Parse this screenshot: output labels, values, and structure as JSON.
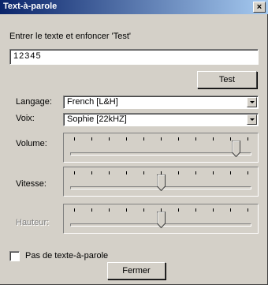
{
  "window": {
    "title": "Text-à-parole",
    "close_label": "×"
  },
  "instruction": "Entrer le texte et enfoncer 'Test'",
  "test_text": {
    "value": "12345"
  },
  "buttons": {
    "test": "Test",
    "close": "Fermer"
  },
  "language": {
    "label": "Langage:",
    "selected": "French [L&H]"
  },
  "voice": {
    "label": "Voix:",
    "selected": "Sophie [22kHZ]"
  },
  "sliders": [
    {
      "key": "volume",
      "label": "Volume:",
      "value": 0.93,
      "ticks": 11,
      "enabled": true
    },
    {
      "key": "vitesse",
      "label": "Vitesse:",
      "value": 0.5,
      "ticks": 11,
      "enabled": true
    },
    {
      "key": "hauteur",
      "label": "Hauteur:",
      "value": 0.5,
      "ticks": 11,
      "enabled": false
    }
  ],
  "no_tts_checkbox": {
    "label": "Pas de texte-à-parole",
    "checked": false
  }
}
